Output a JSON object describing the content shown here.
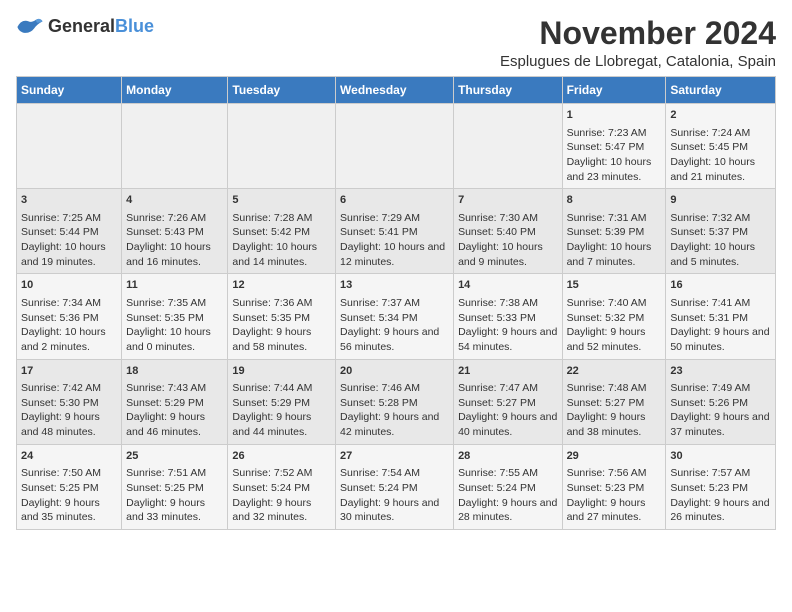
{
  "logo": {
    "general": "General",
    "blue": "Blue"
  },
  "title": "November 2024",
  "subtitle": "Esplugues de Llobregat, Catalonia, Spain",
  "days_header": [
    "Sunday",
    "Monday",
    "Tuesday",
    "Wednesday",
    "Thursday",
    "Friday",
    "Saturday"
  ],
  "weeks": [
    [
      {
        "day": "",
        "content": ""
      },
      {
        "day": "",
        "content": ""
      },
      {
        "day": "",
        "content": ""
      },
      {
        "day": "",
        "content": ""
      },
      {
        "day": "",
        "content": ""
      },
      {
        "day": "1",
        "content": "Sunrise: 7:23 AM\nSunset: 5:47 PM\nDaylight: 10 hours and 23 minutes."
      },
      {
        "day": "2",
        "content": "Sunrise: 7:24 AM\nSunset: 5:45 PM\nDaylight: 10 hours and 21 minutes."
      }
    ],
    [
      {
        "day": "3",
        "content": "Sunrise: 7:25 AM\nSunset: 5:44 PM\nDaylight: 10 hours and 19 minutes."
      },
      {
        "day": "4",
        "content": "Sunrise: 7:26 AM\nSunset: 5:43 PM\nDaylight: 10 hours and 16 minutes."
      },
      {
        "day": "5",
        "content": "Sunrise: 7:28 AM\nSunset: 5:42 PM\nDaylight: 10 hours and 14 minutes."
      },
      {
        "day": "6",
        "content": "Sunrise: 7:29 AM\nSunset: 5:41 PM\nDaylight: 10 hours and 12 minutes."
      },
      {
        "day": "7",
        "content": "Sunrise: 7:30 AM\nSunset: 5:40 PM\nDaylight: 10 hours and 9 minutes."
      },
      {
        "day": "8",
        "content": "Sunrise: 7:31 AM\nSunset: 5:39 PM\nDaylight: 10 hours and 7 minutes."
      },
      {
        "day": "9",
        "content": "Sunrise: 7:32 AM\nSunset: 5:37 PM\nDaylight: 10 hours and 5 minutes."
      }
    ],
    [
      {
        "day": "10",
        "content": "Sunrise: 7:34 AM\nSunset: 5:36 PM\nDaylight: 10 hours and 2 minutes."
      },
      {
        "day": "11",
        "content": "Sunrise: 7:35 AM\nSunset: 5:35 PM\nDaylight: 10 hours and 0 minutes."
      },
      {
        "day": "12",
        "content": "Sunrise: 7:36 AM\nSunset: 5:35 PM\nDaylight: 9 hours and 58 minutes."
      },
      {
        "day": "13",
        "content": "Sunrise: 7:37 AM\nSunset: 5:34 PM\nDaylight: 9 hours and 56 minutes."
      },
      {
        "day": "14",
        "content": "Sunrise: 7:38 AM\nSunset: 5:33 PM\nDaylight: 9 hours and 54 minutes."
      },
      {
        "day": "15",
        "content": "Sunrise: 7:40 AM\nSunset: 5:32 PM\nDaylight: 9 hours and 52 minutes."
      },
      {
        "day": "16",
        "content": "Sunrise: 7:41 AM\nSunset: 5:31 PM\nDaylight: 9 hours and 50 minutes."
      }
    ],
    [
      {
        "day": "17",
        "content": "Sunrise: 7:42 AM\nSunset: 5:30 PM\nDaylight: 9 hours and 48 minutes."
      },
      {
        "day": "18",
        "content": "Sunrise: 7:43 AM\nSunset: 5:29 PM\nDaylight: 9 hours and 46 minutes."
      },
      {
        "day": "19",
        "content": "Sunrise: 7:44 AM\nSunset: 5:29 PM\nDaylight: 9 hours and 44 minutes."
      },
      {
        "day": "20",
        "content": "Sunrise: 7:46 AM\nSunset: 5:28 PM\nDaylight: 9 hours and 42 minutes."
      },
      {
        "day": "21",
        "content": "Sunrise: 7:47 AM\nSunset: 5:27 PM\nDaylight: 9 hours and 40 minutes."
      },
      {
        "day": "22",
        "content": "Sunrise: 7:48 AM\nSunset: 5:27 PM\nDaylight: 9 hours and 38 minutes."
      },
      {
        "day": "23",
        "content": "Sunrise: 7:49 AM\nSunset: 5:26 PM\nDaylight: 9 hours and 37 minutes."
      }
    ],
    [
      {
        "day": "24",
        "content": "Sunrise: 7:50 AM\nSunset: 5:25 PM\nDaylight: 9 hours and 35 minutes."
      },
      {
        "day": "25",
        "content": "Sunrise: 7:51 AM\nSunset: 5:25 PM\nDaylight: 9 hours and 33 minutes."
      },
      {
        "day": "26",
        "content": "Sunrise: 7:52 AM\nSunset: 5:24 PM\nDaylight: 9 hours and 32 minutes."
      },
      {
        "day": "27",
        "content": "Sunrise: 7:54 AM\nSunset: 5:24 PM\nDaylight: 9 hours and 30 minutes."
      },
      {
        "day": "28",
        "content": "Sunrise: 7:55 AM\nSunset: 5:24 PM\nDaylight: 9 hours and 28 minutes."
      },
      {
        "day": "29",
        "content": "Sunrise: 7:56 AM\nSunset: 5:23 PM\nDaylight: 9 hours and 27 minutes."
      },
      {
        "day": "30",
        "content": "Sunrise: 7:57 AM\nSunset: 5:23 PM\nDaylight: 9 hours and 26 minutes."
      }
    ]
  ]
}
